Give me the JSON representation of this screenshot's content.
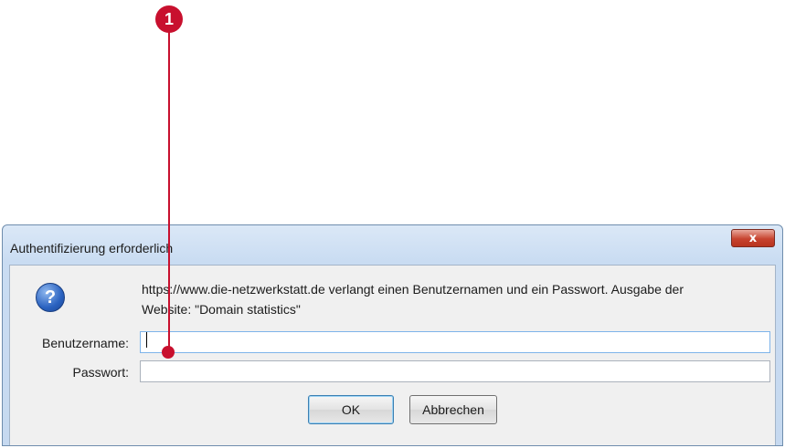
{
  "callout": {
    "number": "1"
  },
  "dialog": {
    "title": "Authentifizierung erforderlich",
    "close_label": "x",
    "message_line1": "https://www.die-netzwerkstatt.de verlangt einen Benutzernamen und ein Passwort. Ausgabe der",
    "message_line2": "Website: \"Domain statistics\"",
    "username_label": "Benutzername:",
    "username_value": "",
    "password_label": "Passwort:",
    "password_value": "",
    "ok_label": "OK",
    "cancel_label": "Abbrechen",
    "icon": "question-icon"
  },
  "colors": {
    "callout": "#c8102e",
    "close_button": "#c7432f",
    "title_bar": "#c9dcf2"
  }
}
